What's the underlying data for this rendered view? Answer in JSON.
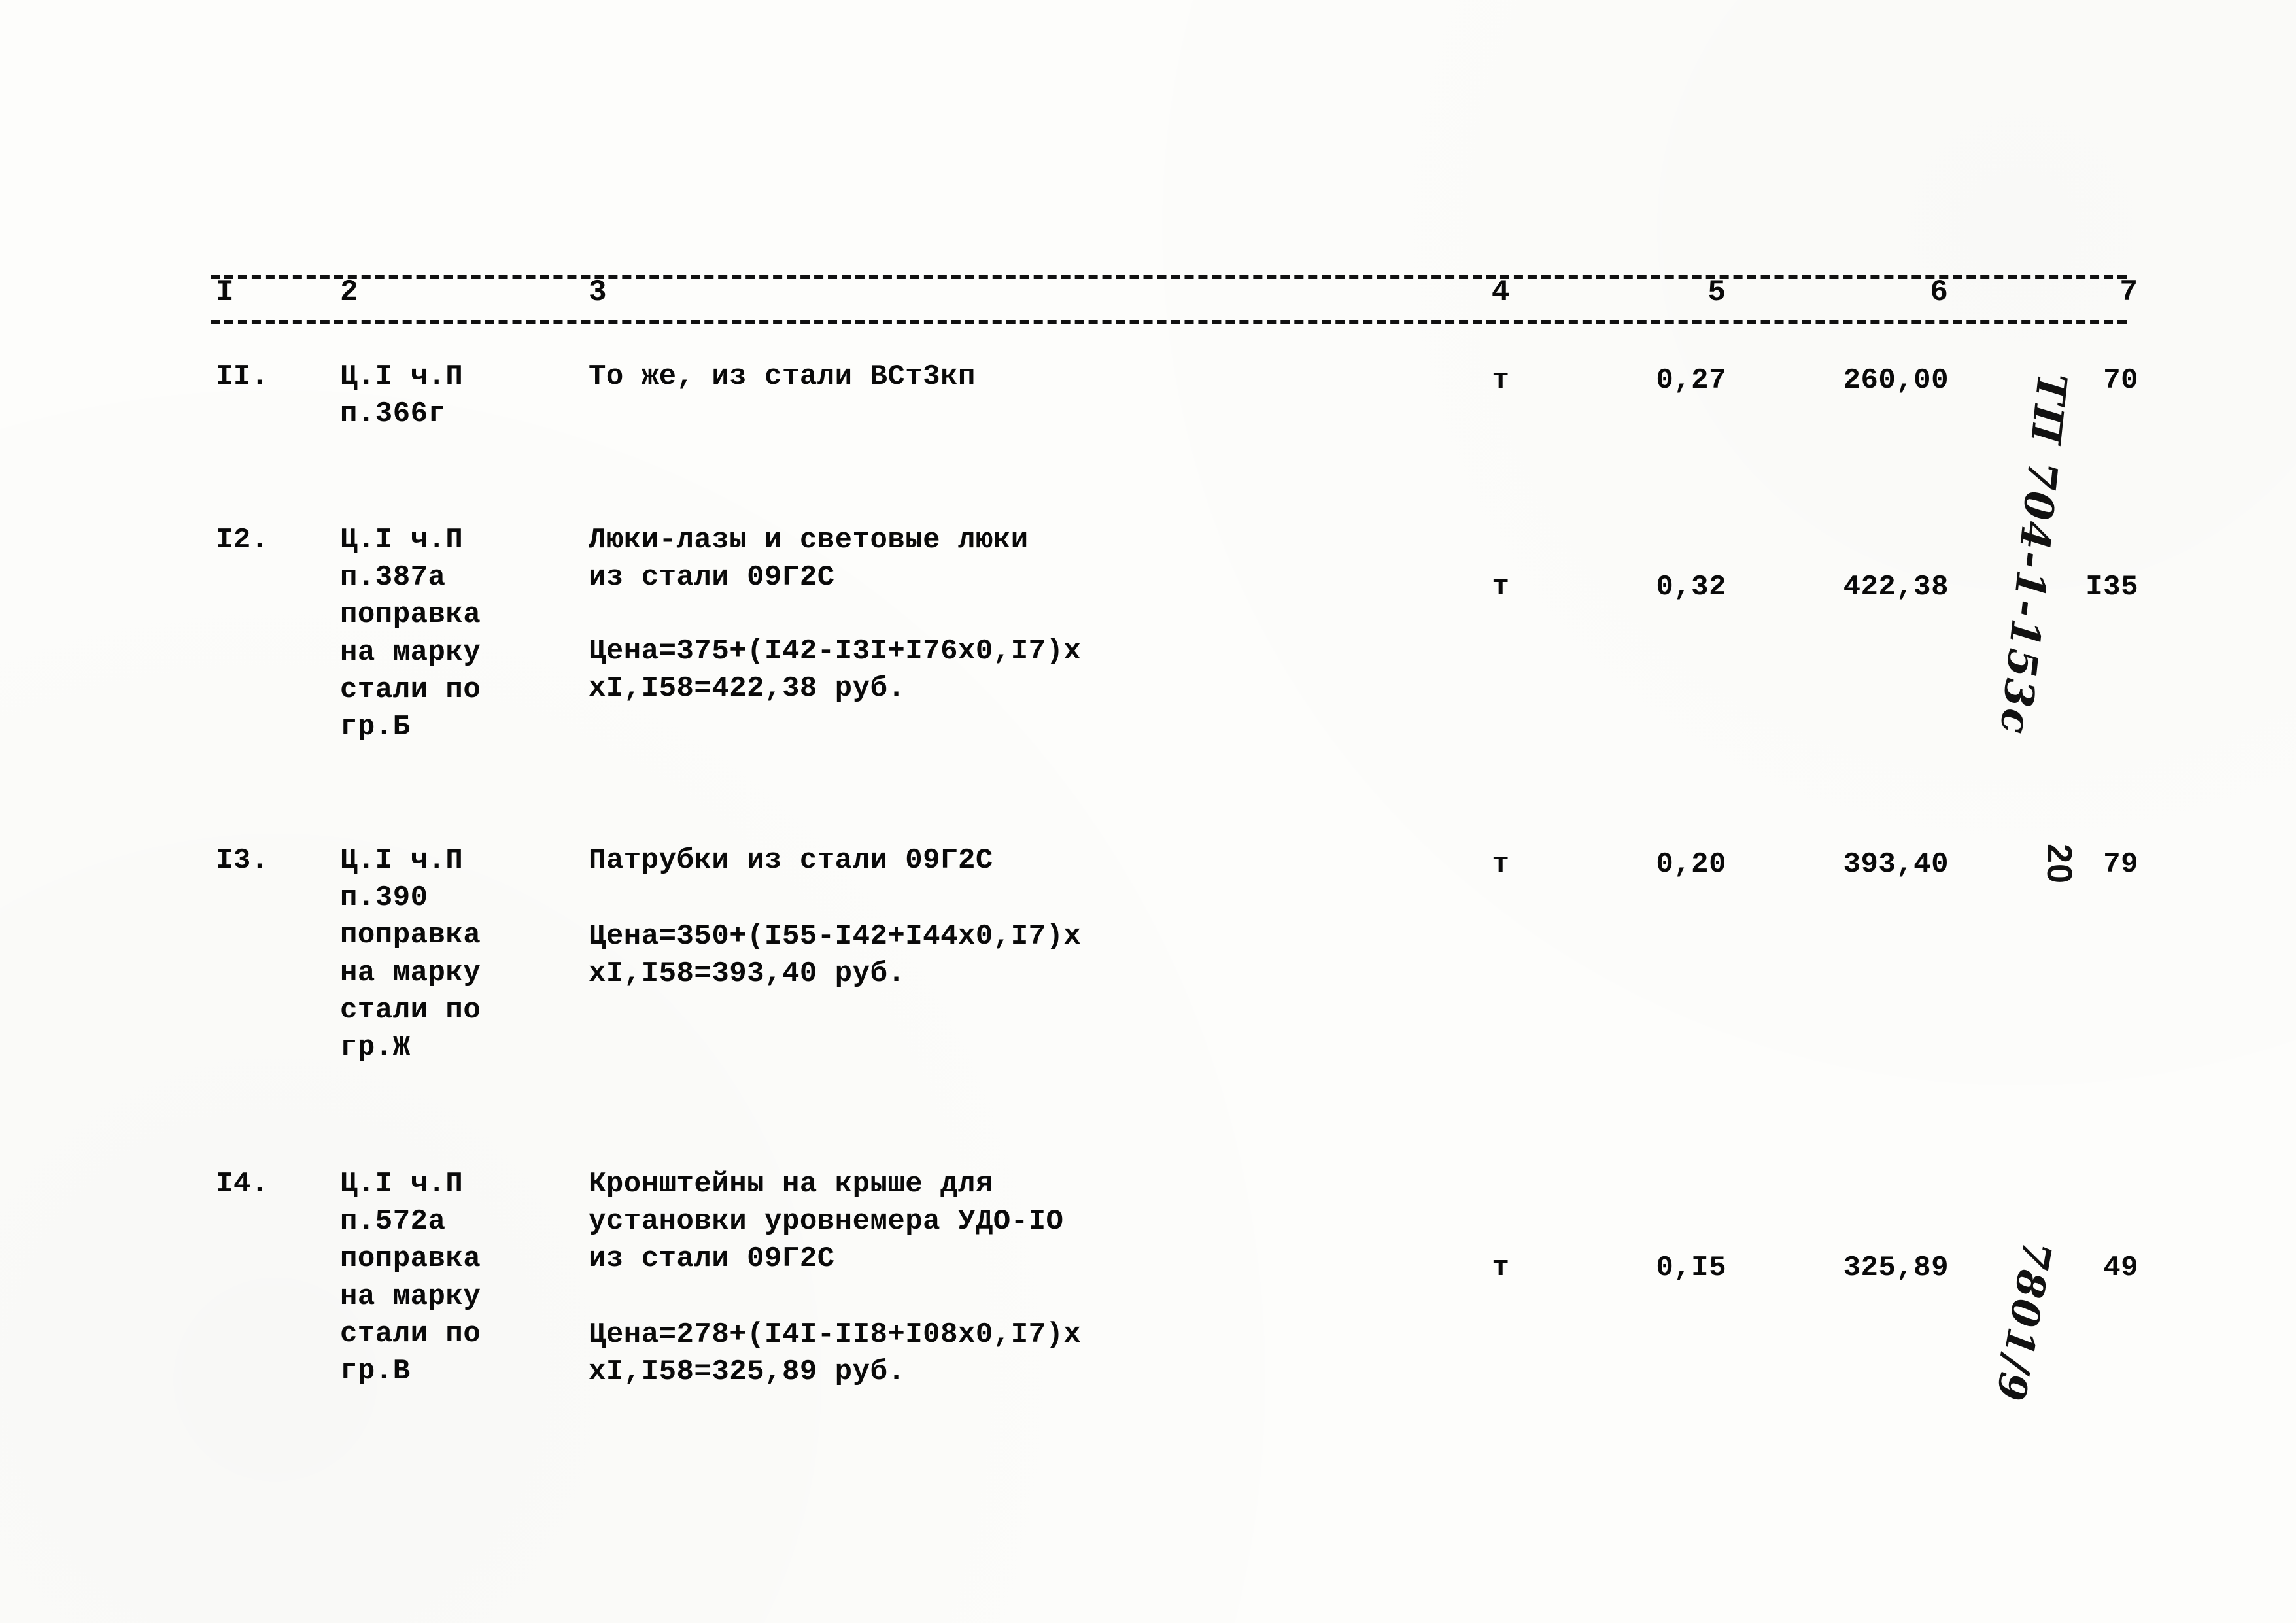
{
  "table": {
    "column_numbers": [
      "I",
      "2",
      "3",
      "4",
      "5",
      "6",
      "7"
    ],
    "rows": [
      {
        "num": "II.",
        "justification": "Ц.I ч.П\nп.366г",
        "description": "То же, из стали ВСт3кп",
        "formula": "",
        "unit": "т",
        "quantity": "0,27",
        "price": "260,00",
        "sum": "70"
      },
      {
        "num": "I2.",
        "justification": "Ц.I ч.П\nп.387а\nпоправка\nна марку\nстали по\nгр.Б",
        "description": "Люки-лазы и световые люки\nиз стали 09Г2С",
        "formula": "Цена=375+(I42-I3I+I76х0,I7)х\nхI,I58=422,38 руб.",
        "unit": "т",
        "quantity": "0,32",
        "price": "422,38",
        "sum": "I35"
      },
      {
        "num": "I3.",
        "justification": "Ц.I ч.П\nп.390\nпоправка\nна марку\nстали по\nгр.Ж",
        "description": "Патрубки из стали 09Г2С",
        "formula": "Цена=350+(I55-I42+I44х0,I7)х\nхI,I58=393,40 руб.",
        "unit": "т",
        "quantity": "0,20",
        "price": "393,40",
        "sum": "79"
      },
      {
        "num": "I4.",
        "justification": "Ц.I ч.П\nп.572а\nпоправка\nна марку\nстали по\nгр.В",
        "description": "Кронштейны на крыше для\nустановки уровнемера УДО-IO\nиз стали 09Г2С",
        "formula": "Цена=278+(I4I-II8+I08х0,I7)х\nхI,I58=325,89 руб.",
        "unit": "т",
        "quantity": "0,I5",
        "price": "325,89",
        "sum": "49"
      }
    ]
  },
  "annotations": {
    "project_code": "ТП 704-1-153с",
    "page_number": "20",
    "order_number": "7801/9"
  }
}
